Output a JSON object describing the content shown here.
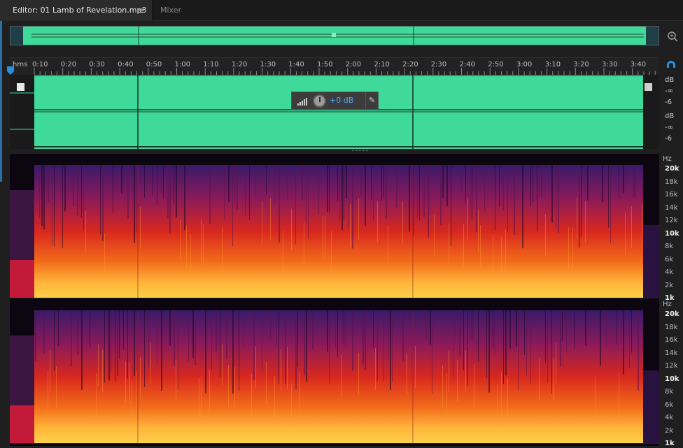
{
  "tabs": {
    "editor_label": "Editor: 01 Lamb of Revelation.mp3",
    "editor_menu_icon": "hamburger-icon",
    "mixer_label": "Mixer"
  },
  "ruler": {
    "unit": "hms",
    "ticks": [
      "0:10",
      "0:20",
      "0:30",
      "0:40",
      "0:50",
      "1:00",
      "1:10",
      "1:20",
      "1:30",
      "1:40",
      "1:50",
      "2:00",
      "2:10",
      "2:20",
      "2:30",
      "2:40",
      "2:50",
      "3:00",
      "3:10",
      "3:20",
      "3:30",
      "3:40"
    ]
  },
  "hud": {
    "gain": "+0 dB"
  },
  "amplitude_scale": {
    "ch1": [
      "dB",
      "-∞",
      "-6"
    ],
    "ch2": [
      "dB",
      "-∞",
      "-6"
    ]
  },
  "frequency_scale": {
    "unit": "Hz",
    "labels": [
      "20k",
      "18k",
      "16k",
      "14k",
      "12k",
      "10k",
      "8k",
      "6k",
      "4k",
      "2k",
      "1k"
    ]
  },
  "colors": {
    "waveform": "#3fd99a",
    "accent": "#2b8fe0",
    "spectro_high": "#ffd24a",
    "spectro_mid": "#e8321e",
    "spectro_low": "#3a1a6a"
  }
}
